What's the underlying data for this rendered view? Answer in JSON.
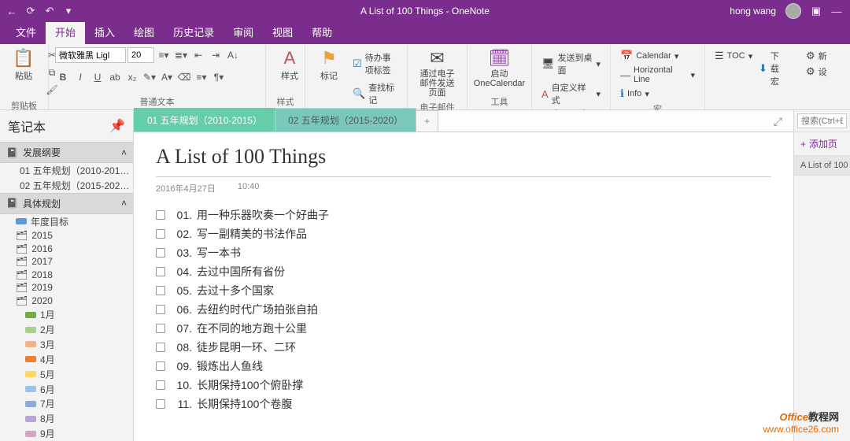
{
  "titlebar": {
    "doc_title": "A List of 100 Things",
    "app_name": "OneNote",
    "separator": "  -  ",
    "user": "hong wang"
  },
  "menu": {
    "tabs": [
      "文件",
      "开始",
      "插入",
      "绘图",
      "历史记录",
      "审阅",
      "视图",
      "帮助"
    ],
    "active_index": 1
  },
  "ribbon": {
    "clipboard": {
      "paste": "粘贴",
      "label": "剪贴板"
    },
    "font": {
      "name": "微软雅黑 Ligl",
      "size": "20",
      "label": "普通文本"
    },
    "styles": {
      "btn": "样式",
      "label": "样式"
    },
    "tags": {
      "btn": "标记",
      "todo": "待办事项标签",
      "find": "查找标记",
      "label": "标记"
    },
    "email": {
      "btn": "通过电子邮件发送页面",
      "label": "电子邮件"
    },
    "tools": {
      "btn": "启动OneCalendar",
      "label": "工具"
    },
    "onetastic": {
      "desktop": "发送到桌面",
      "custom": "自定义样式",
      "label": "Onetastic"
    },
    "macros": {
      "calendar": "Calendar",
      "hr": "Horizontal Line",
      "info": "Info",
      "toc": "TOC",
      "dl": "下载宏",
      "new": "新",
      "set": "设",
      "label": "宏"
    }
  },
  "sidebar": {
    "title": "笔记本",
    "section1": "发展纲要",
    "sec1_items": [
      "01 五年规划（2010-201…",
      "02 五年规划（2015-202…"
    ],
    "section2": "具体规划",
    "sec2_top": "年度目标",
    "years": [
      "2015",
      "2016",
      "2017",
      "2018",
      "2019",
      "2020"
    ],
    "months": [
      "1月",
      "2月",
      "3月",
      "4月",
      "5月",
      "6月",
      "7月",
      "8月",
      "9月"
    ]
  },
  "note_tabs": {
    "tab1": "01 五年规划（2010-2015）",
    "tab2": "02 五年规划（2015-2020）",
    "add": "+"
  },
  "note": {
    "title": "A List of 100 Things",
    "date": "2016年4月27日",
    "time": "10:40",
    "items": [
      {
        "n": "01.",
        "t": "用一种乐器吹奏一个好曲子"
      },
      {
        "n": "02.",
        "t": "写一副精美的书法作品"
      },
      {
        "n": "03.",
        "t": "写一本书"
      },
      {
        "n": "04.",
        "t": "去过中国所有省份"
      },
      {
        "n": "05.",
        "t": "去过十多个国家"
      },
      {
        "n": "06.",
        "t": "去纽约时代广场拍张自拍"
      },
      {
        "n": "07.",
        "t": "在不同的地方跑十公里"
      },
      {
        "n": "08.",
        "t": "徒步昆明一环、二环"
      },
      {
        "n": "09.",
        "t": "锻炼出人鱼线"
      },
      {
        "n": "10.",
        "t": "长期保持100个俯卧撑"
      },
      {
        "n": "11.",
        "t": "长期保持100个卷腹"
      }
    ]
  },
  "pagelist": {
    "search_ph": "搜索(Ctrl+E)",
    "add": "添加页",
    "item": "A List of 100"
  },
  "watermark": {
    "l1a": "Office",
    "l1b": "教程网",
    "l2": "www.office26.com"
  }
}
